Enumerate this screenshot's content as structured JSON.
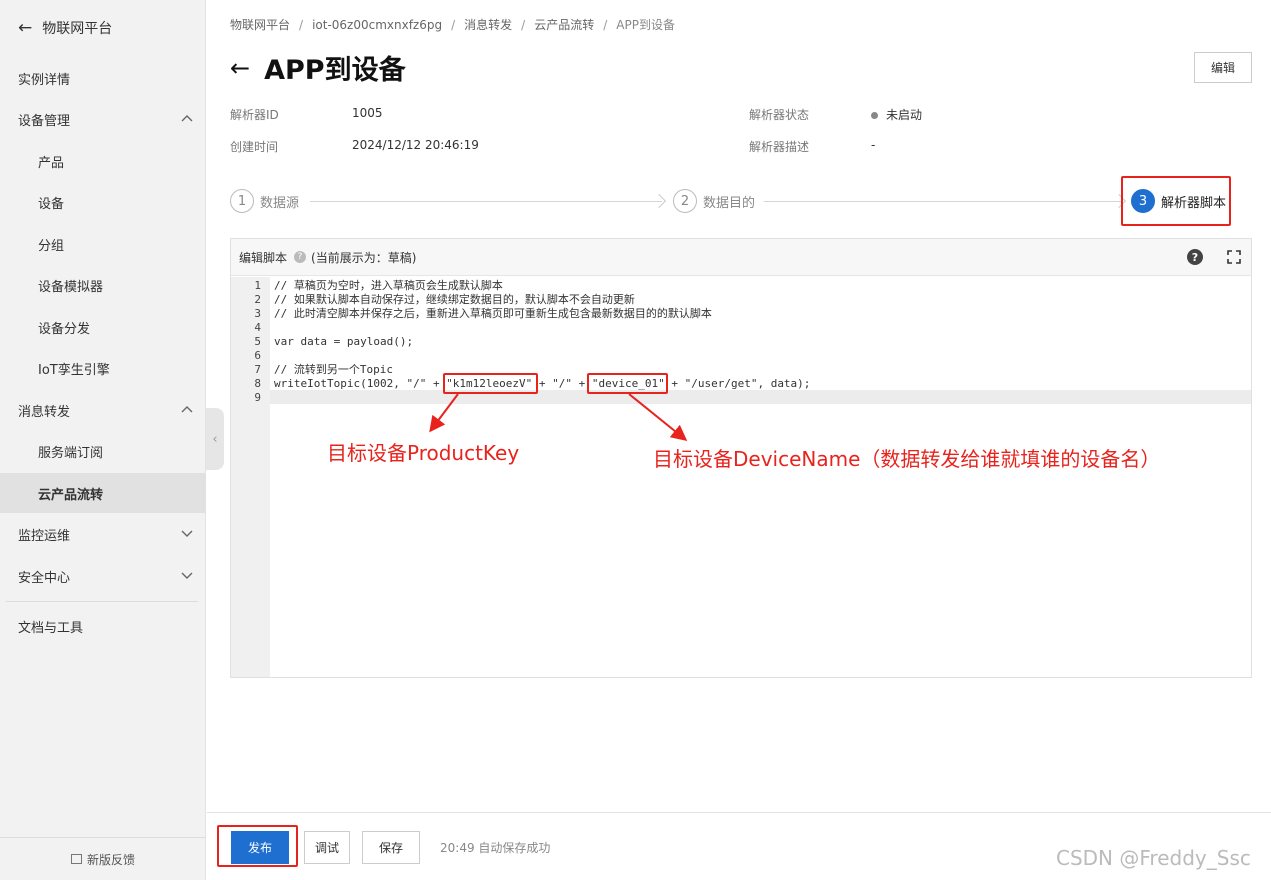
{
  "sidebar": {
    "back_label": "物联网平台",
    "items": [
      {
        "label": "实例详情"
      },
      {
        "label": "设备管理"
      },
      {
        "label": "产品"
      },
      {
        "label": "设备"
      },
      {
        "label": "分组"
      },
      {
        "label": "设备模拟器"
      },
      {
        "label": "设备分发"
      },
      {
        "label": "IoT孪生引擎"
      },
      {
        "label": "消息转发"
      },
      {
        "label": "服务端订阅"
      },
      {
        "label": "云产品流转"
      },
      {
        "label": "监控运维"
      },
      {
        "label": "安全中心"
      },
      {
        "label": "文档与工具"
      }
    ],
    "feedback": "新版反馈"
  },
  "breadcrumb": [
    "物联网平台",
    "iot-06z00cmxnxfz6pg",
    "消息转发",
    "云产品流转",
    "APP到设备"
  ],
  "page": {
    "title": "APP到设备",
    "edit_button": "编辑"
  },
  "info": {
    "parser_id_label": "解析器ID",
    "parser_id": "1005",
    "created_label": "创建时间",
    "created": "2024/12/12 20:46:19",
    "status_label": "解析器状态",
    "status": "未启动",
    "desc_label": "解析器描述",
    "desc": "-"
  },
  "steps": [
    {
      "num": "1",
      "label": "数据源"
    },
    {
      "num": "2",
      "label": "数据目的"
    },
    {
      "num": "3",
      "label": "解析器脚本"
    }
  ],
  "editor": {
    "title": "编辑脚本",
    "draft_note": "(当前展示为：草稿)",
    "lines": [
      "// 草稿页为空时，进入草稿页会生成默认脚本",
      "// 如果默认脚本自动保存过，继续绑定数据目的，默认脚本不会自动更新",
      "// 此时清空脚本并保存之后，重新进入草稿页即可重新生成包含最新数据目的的默认脚本",
      "",
      "var data = payload();",
      "",
      "// 流转到另一个Topic",
      "writeIotTopic(1002, \"/\" + \"k1m12leoezV\" + \"/\" + \"device_01\" + \"/user/get\", data);",
      ""
    ]
  },
  "annotations": {
    "product_key": "目标设备ProductKey",
    "device_name": "目标设备DeviceName（数据转发给谁就填谁的设备名）"
  },
  "actions": {
    "publish": "发布",
    "debug": "调试",
    "save": "保存",
    "autosave": "20:49 自动保存成功"
  },
  "watermark": "CSDN @Freddy_Ssc",
  "colors": {
    "primary": "#1f6fd1",
    "highlight": "#e8231d"
  }
}
